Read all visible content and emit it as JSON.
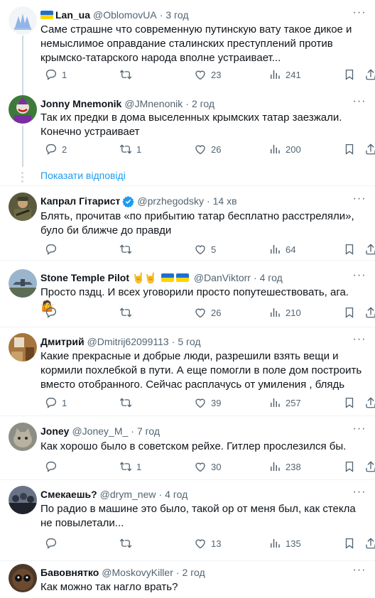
{
  "show_replies_label": "Показати відповіді",
  "tweets": [
    {
      "name": "Lan_ua",
      "handle": "@OblomovUA",
      "time": "3 год",
      "text": "Саме страшне что современную путинскую вату такое дикое и немыслимое оправдание сталинских преступлений против крымско-татарского народа вполне устраивает...",
      "replies": "1",
      "retweets": "",
      "likes": "23",
      "views": "241"
    },
    {
      "name": "Jonny Mnemonik",
      "handle": "@JMnenonik",
      "time": "2 год",
      "text": "Так их предки в дома выселенных крымских татар заезжали. Конечно устраивает",
      "replies": "2",
      "retweets": "1",
      "likes": "26",
      "views": "200"
    },
    {
      "name": "Капрал Гітарист",
      "handle": "@przhegodsky",
      "time": "14 хв",
      "text": "Блять, прочитав «по прибытию татар бесплатно расстреляли», було би ближче до правди",
      "replies": "",
      "retweets": "",
      "likes": "5",
      "views": "64"
    },
    {
      "name": "Stone Temple Pilot",
      "handle": "@DanViktorr",
      "time": "4 год",
      "text": "Просто пздц. И всех уговорили просто попутешествовать, ага.",
      "replies": "",
      "retweets": "",
      "likes": "26",
      "views": "210"
    },
    {
      "name": "Дмитрий",
      "handle": "@Dmitrij62099113",
      "time": "5 год",
      "text": "Какие прекрасные и добрые люди, разрешили взять вещи и кормили похлебкой в пути. А еще помогли в поле дом построить вместо отобранного. Сейчас расплачусь от умиления , блядь",
      "replies": "1",
      "retweets": "",
      "likes": "39",
      "views": "257"
    },
    {
      "name": "Joney",
      "handle": "@Joney_M_",
      "time": "7 год",
      "text": "Как хорошо было в советском рейхе. Гитлер прослезился бы.",
      "replies": "",
      "retweets": "1",
      "likes": "30",
      "views": "238"
    },
    {
      "name": "Смекаешь?",
      "handle": "@drym_new",
      "time": "4 год",
      "text": "По радио в машине это было, такой ор от меня был, как стекла не повылетали...",
      "replies": "",
      "retweets": "",
      "likes": "13",
      "views": "135"
    },
    {
      "name": "Бавовнятко",
      "handle": "@MoskovyKiller",
      "time": "2 год",
      "text": "Как можно так нагло врать?",
      "replies": "",
      "retweets": "",
      "likes": "",
      "views": ""
    }
  ],
  "colors": {
    "link": "#1d9bf0",
    "secondary": "#536471",
    "divider": "#eff3f4"
  }
}
